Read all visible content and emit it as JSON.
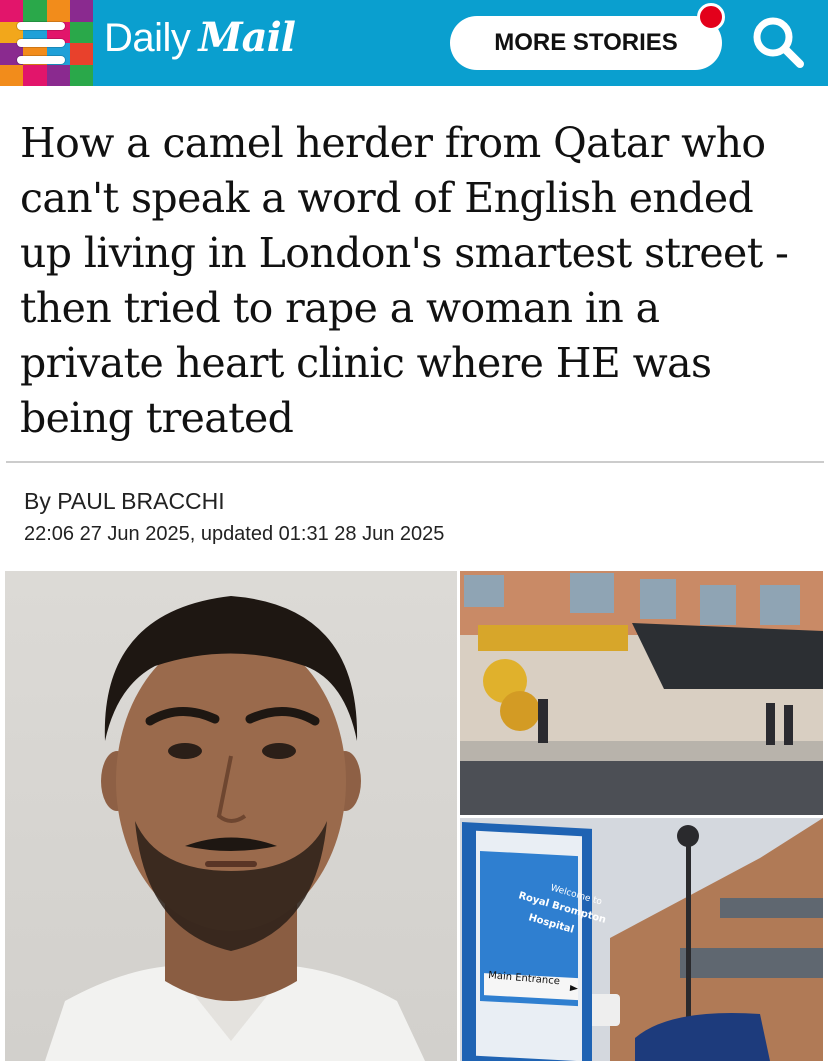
{
  "header": {
    "brand_daily": "Daily",
    "brand_mail": "Mail",
    "more_stories_label": "MORE STORIES",
    "background_color": "#0a9fcf",
    "notification_color": "#e3001b",
    "menu_icon": "hamburger-menu-icon",
    "search_icon": "search-icon"
  },
  "article": {
    "headline": "How a camel herder from Qatar who can't speak a word of English ended up living in London's smartest street - then tried to rape a woman in a private heart clinic where HE was being treated",
    "byline_prefix": "By ",
    "author": "PAUL BRACCHI",
    "dateline": "22:06 27 Jun 2025, updated 01:31 28 Jun 2025"
  },
  "images": {
    "hospital_sign_welcome": "Welcome to",
    "hospital_sign_name_1": "Royal Brompton",
    "hospital_sign_name_2": "Hospital",
    "hospital_sign_entrance": "Main Entrance"
  }
}
